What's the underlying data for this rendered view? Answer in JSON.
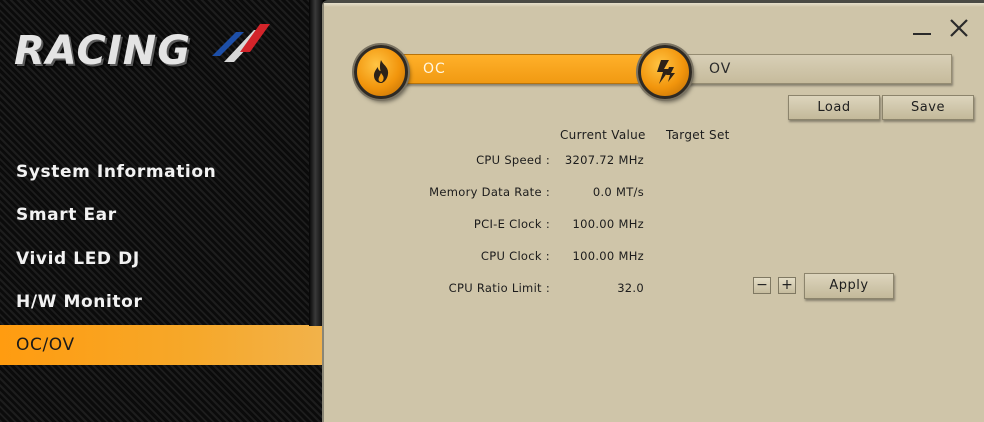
{
  "logo": {
    "text": "RACING"
  },
  "sidebar": {
    "items": [
      {
        "label": "System Information"
      },
      {
        "label": "Smart Ear"
      },
      {
        "label": "Vivid LED DJ"
      },
      {
        "label": "H/W Monitor"
      },
      {
        "label": "OC/OV",
        "active": true
      }
    ]
  },
  "window": {
    "minimize_icon": "minimize-icon",
    "close_icon": "close-icon"
  },
  "tabs": [
    {
      "label": "OC",
      "icon": "flame-icon",
      "active": true
    },
    {
      "label": "OV",
      "icon": "lightning-icon",
      "active": false
    }
  ],
  "toolbar": {
    "load_label": "Load",
    "save_label": "Save"
  },
  "table": {
    "headers": {
      "current": "Current Value",
      "target": "Target Set"
    },
    "rows": [
      {
        "label": "CPU Speed :",
        "value": "3207.72 MHz"
      },
      {
        "label": "Memory Data Rate :",
        "value": "0.0 MT/s"
      },
      {
        "label": "PCI-E Clock :",
        "value": "100.00 MHz"
      },
      {
        "label": "CPU Clock :",
        "value": "100.00 MHz"
      },
      {
        "label": "CPU Ratio Limit :",
        "value": "32.0"
      }
    ]
  },
  "controls": {
    "minus_label": "−",
    "plus_label": "+",
    "apply_label": "Apply"
  },
  "colors": {
    "accent": "#f4a21c",
    "panel": "#cfc5a9",
    "sidebar": "#0e0e0e"
  }
}
